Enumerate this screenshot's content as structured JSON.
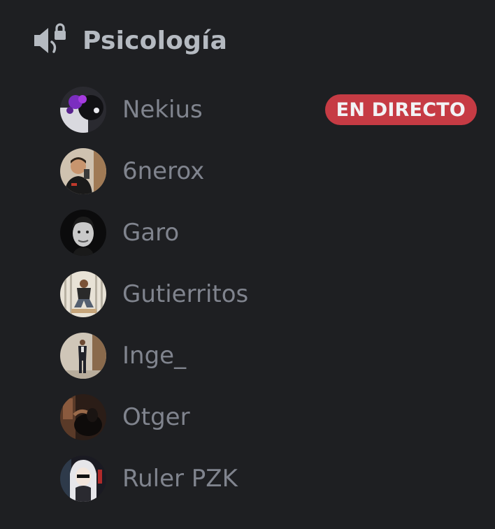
{
  "channel": {
    "name": "Psicología",
    "icon": "speaker-lock-icon"
  },
  "members": [
    {
      "name": "Nekius",
      "avatar": "avatar-nekius",
      "badge": "EN DIRECTO"
    },
    {
      "name": "6nerox",
      "avatar": "avatar-6nerox"
    },
    {
      "name": "Garo",
      "avatar": "avatar-garo"
    },
    {
      "name": "Gutierritos",
      "avatar": "avatar-gutierritos"
    },
    {
      "name": "Inge_",
      "avatar": "avatar-inge"
    },
    {
      "name": "Otger",
      "avatar": "avatar-otger"
    },
    {
      "name": "Ruler PZK",
      "avatar": "avatar-ruler"
    }
  ],
  "colors": {
    "background": "#1e1f22",
    "channel_text": "#b5bac1",
    "member_text": "#80848e",
    "live_badge": "#c63b44"
  }
}
